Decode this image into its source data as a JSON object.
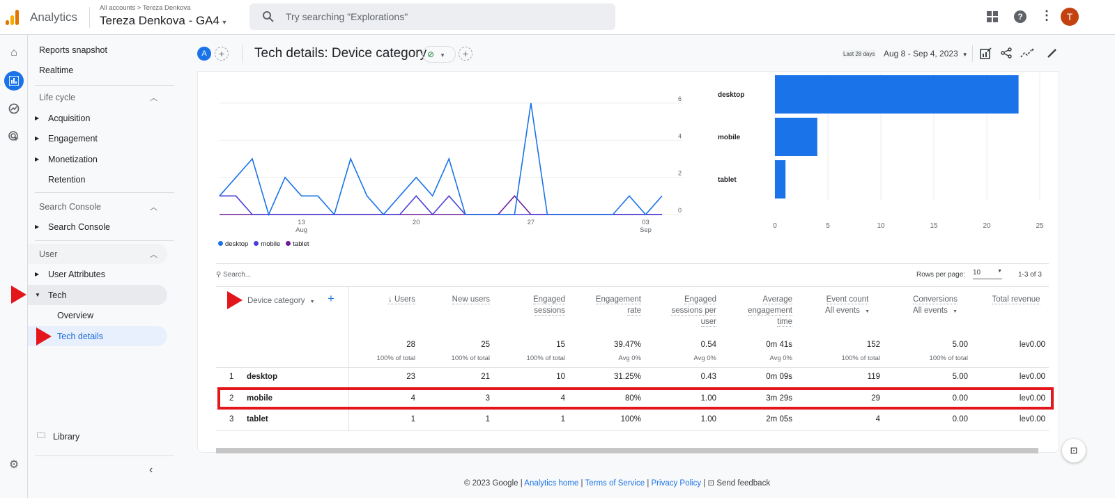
{
  "topbar": {
    "app": "Analytics",
    "breadcrumb": "All accounts > Tereza Denkova",
    "property": "Tereza Denkova - GA4",
    "search_placeholder": "Try searching \"Explorations\"",
    "avatar": "T",
    "icons": [
      "apps-icon",
      "help-icon",
      "more-vert-icon"
    ]
  },
  "sidebar": {
    "reports_snapshot": "Reports snapshot",
    "realtime": "Realtime",
    "lifecycle": "Life cycle",
    "acquisition": "Acquisition",
    "engagement": "Engagement",
    "monetization": "Monetization",
    "retention": "Retention",
    "search_console_head": "Search Console",
    "search_console": "Search Console",
    "user_head": "User",
    "user_attributes": "User Attributes",
    "tech": "Tech",
    "overview": "Overview",
    "tech_details": "Tech details",
    "library": "Library"
  },
  "header": {
    "avatar": "A",
    "title": "Tech details: Device category",
    "date_label": "Last 28 days",
    "date_range": "Aug 8 - Sep 4, 2023"
  },
  "chart_data": [
    {
      "type": "line",
      "x": [
        "Aug 8",
        "Aug 9",
        "Aug 10",
        "Aug 11",
        "Aug 12",
        "Aug 13",
        "Aug 14",
        "Aug 15",
        "Aug 16",
        "Aug 17",
        "Aug 18",
        "Aug 19",
        "Aug 20",
        "Aug 21",
        "Aug 22",
        "Aug 23",
        "Aug 24",
        "Aug 25",
        "Aug 26",
        "Aug 27",
        "Aug 28",
        "Aug 29",
        "Aug 30",
        "Aug 31",
        "Sep 1",
        "Sep 2",
        "Sep 3",
        "Sep 4"
      ],
      "x_ticks": [
        {
          "day": "13",
          "month": "Aug",
          "index": 5
        },
        {
          "day": "20",
          "month": "",
          "index": 12
        },
        {
          "day": "27",
          "month": "",
          "index": 19
        },
        {
          "day": "03",
          "month": "Sep",
          "index": 26
        }
      ],
      "y_ticks": [
        0,
        2,
        4,
        6
      ],
      "ylim": [
        0,
        6
      ],
      "grid": true,
      "legend": "bottom-left",
      "series": [
        {
          "name": "desktop",
          "color": "#1a73e8",
          "values": [
            1,
            2,
            3,
            0,
            2,
            1,
            1,
            0,
            3,
            1,
            0,
            1,
            2,
            1,
            3,
            0,
            0,
            0,
            0,
            6,
            0,
            0,
            0,
            0,
            0,
            1,
            0,
            1
          ]
        },
        {
          "name": "mobile",
          "color": "#4a3fd6",
          "values": [
            1,
            1,
            0,
            0,
            0,
            0,
            0,
            0,
            0,
            0,
            0,
            0,
            1,
            0,
            1,
            0,
            0,
            0,
            0,
            0,
            0,
            0,
            0,
            0,
            0,
            0,
            0,
            0
          ]
        },
        {
          "name": "tablet",
          "color": "#6a1b9a",
          "values": [
            0,
            0,
            0,
            0,
            0,
            0,
            0,
            0,
            0,
            0,
            0,
            0,
            0,
            0,
            0,
            0,
            0,
            0,
            1,
            0,
            0,
            0,
            0,
            0,
            0,
            0,
            0,
            0
          ]
        }
      ]
    },
    {
      "type": "bar",
      "orientation": "horizontal",
      "categories": [
        "desktop",
        "mobile",
        "tablet"
      ],
      "values": [
        23,
        4,
        1
      ],
      "x_ticks": [
        0,
        5,
        10,
        15,
        20,
        25
      ],
      "xlim": [
        0,
        25
      ],
      "color": "#1a73e8",
      "grid": true
    }
  ],
  "table": {
    "search_placeholder": "Search...",
    "rows_per_page_label": "Rows per page:",
    "rows_per_page": "10",
    "pagination": "1-3 of 3",
    "dim_header": "Device category",
    "columns": [
      {
        "label": "↓ Users",
        "total": "28",
        "total_sub": "100% of total"
      },
      {
        "label": "New users",
        "total": "25",
        "total_sub": "100% of total"
      },
      {
        "label": "Engaged sessions",
        "total": "15",
        "total_sub": "100% of total"
      },
      {
        "label": "Engagement rate",
        "total": "39.47%",
        "total_sub": "Avg 0%"
      },
      {
        "label": "Engaged sessions per user",
        "total": "0.54",
        "total_sub": "Avg 0%"
      },
      {
        "label": "Average engagement time",
        "total": "0m 41s",
        "total_sub": "Avg 0%"
      },
      {
        "label": "Event count",
        "selector": "All events",
        "total": "152",
        "total_sub": "100% of total"
      },
      {
        "label": "Conversions",
        "selector": "All events",
        "total": "5.00",
        "total_sub": "100% of total"
      },
      {
        "label": "Total revenue",
        "total": "lev0.00",
        "total_sub": ""
      }
    ],
    "rows": [
      {
        "rank": "1",
        "name": "desktop",
        "values": [
          "23",
          "21",
          "10",
          "31.25%",
          "0.43",
          "0m 09s",
          "119",
          "5.00",
          "lev0.00"
        ]
      },
      {
        "rank": "2",
        "name": "mobile",
        "values": [
          "4",
          "3",
          "4",
          "80%",
          "1.00",
          "3m 29s",
          "29",
          "0.00",
          "lev0.00"
        ],
        "highlighted": true
      },
      {
        "rank": "3",
        "name": "tablet",
        "values": [
          "1",
          "1",
          "1",
          "100%",
          "1.00",
          "2m 05s",
          "4",
          "0.00",
          "lev0.00"
        ]
      }
    ]
  },
  "footer": {
    "copyright": "© 2023 Google |",
    "analytics_home": "Analytics home",
    "terms": "Terms of Service",
    "privacy": "Privacy Policy",
    "feedback": "Send feedback",
    "sep": "|"
  },
  "colors": {
    "accent": "#1a73e8",
    "highlight": "#e3161b"
  }
}
